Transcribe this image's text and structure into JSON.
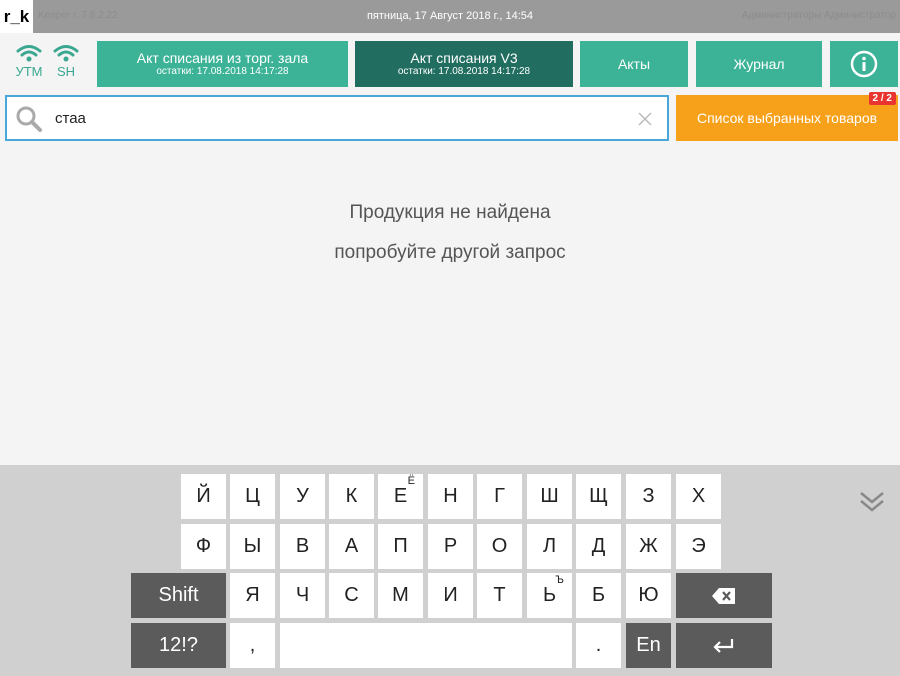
{
  "topbar": {
    "logo": "r_k",
    "version": "Keeper r. 7.6.2.22",
    "datetime": "пятница, 17 Август 2018 г., 14:54",
    "user": "Администраторы Администратор"
  },
  "connections": [
    {
      "label": "УТМ",
      "icon": "wifi-icon"
    },
    {
      "label": "SH",
      "icon": "wifi-icon"
    }
  ],
  "header_buttons": {
    "act_hall": {
      "title": "Акт списания из торг. зала",
      "subtitle": "остатки: 17.08.2018 14:17:28"
    },
    "act_v3": {
      "title": "Акт списания V3",
      "subtitle": "остатки: 17.08.2018 14:17:28"
    },
    "acts": "Акты",
    "journal": "Журнал",
    "info_icon": "info-icon"
  },
  "search": {
    "value": "стаа",
    "placeholder": "",
    "icon": "search-icon",
    "clear_icon": "close-icon"
  },
  "selected_list": {
    "label": "Список выбранных товаров",
    "badge": "2 / 2"
  },
  "empty_state": {
    "line1": "Продукция не найдена",
    "line2": "попробуйте другой запрос"
  },
  "colors": {
    "accent": "#3cb397",
    "accent_dark": "#216d5f",
    "orange": "#f7a11a",
    "badge_red": "#e8352f",
    "search_border": "#4aa8d8",
    "key_dark": "#5b5b5b"
  },
  "keyboard": {
    "rows": [
      [
        "Й",
        "Ц",
        "У",
        "К",
        "Е",
        "Н",
        "Г",
        "Ш",
        "Щ",
        "З",
        "Х"
      ],
      [
        "Ф",
        "Ы",
        "В",
        "А",
        "П",
        "Р",
        "О",
        "Л",
        "Д",
        "Ж",
        "Э"
      ],
      [
        "Я",
        "Ч",
        "С",
        "М",
        "И",
        "Т",
        "Ь",
        "Б",
        "Ю"
      ]
    ],
    "alt_e": "Ё",
    "alt_soft": "Ъ",
    "shift": "Shift",
    "numbers": "12!?",
    "comma": ",",
    "period": ".",
    "lang": "En",
    "backspace_icon": "backspace-icon",
    "enter_icon": "enter-icon",
    "hide_icon": "chevron-double-down-icon"
  }
}
